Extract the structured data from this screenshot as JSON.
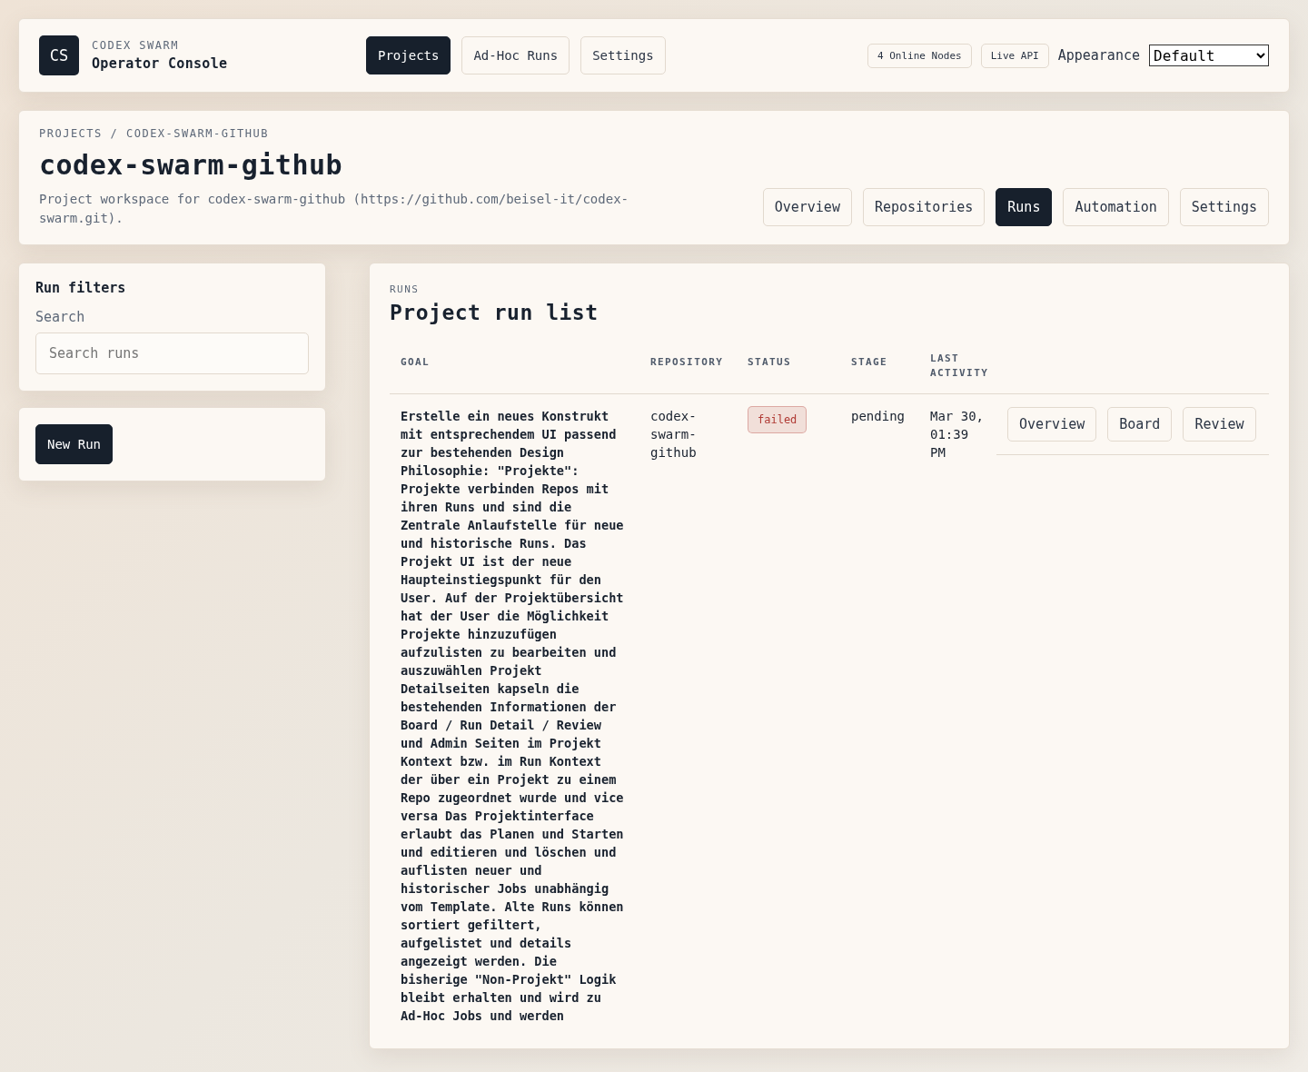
{
  "header": {
    "logo": "CS",
    "eyebrow": "CODEX SWARM",
    "title": "Operator Console",
    "nav": [
      {
        "label": "Projects",
        "selected": true
      },
      {
        "label": "Ad-Hoc Runs",
        "selected": false
      },
      {
        "label": "Settings",
        "selected": false
      }
    ],
    "badges": [
      "4 Online Nodes",
      "Live API"
    ],
    "appearance": {
      "label": "Appearance",
      "value": "Default"
    }
  },
  "project": {
    "breadcrumb": "PROJECTS / CODEX-SWARM-GITHUB",
    "title": "codex-swarm-github",
    "description": "Project workspace for codex-swarm-github (https://github.com/beisel-it/codex-swarm.git).",
    "tabs": [
      {
        "label": "Overview",
        "selected": false
      },
      {
        "label": "Repositories",
        "selected": false
      },
      {
        "label": "Runs",
        "selected": true
      },
      {
        "label": "Automation",
        "selected": false
      },
      {
        "label": "Settings",
        "selected": false
      }
    ]
  },
  "sidebar": {
    "filters": {
      "title": "Run filters",
      "search_label": "Search",
      "search_placeholder": "Search runs"
    },
    "new_run_button": "New Run"
  },
  "runs": {
    "eyebrow": "RUNS",
    "title": "Project run list",
    "columns": [
      "GOAL",
      "REPOSITORY",
      "STATUS",
      "STAGE",
      "LAST ACTIVITY"
    ],
    "rows": [
      {
        "goal": "Erstelle ein neues Konstrukt mit entsprechendem UI passend zur bestehenden Design Philosophie: \"Projekte\": Projekte verbinden Repos mit ihren Runs und sind die Zentrale Anlaufstelle für neue und historische Runs. Das Projekt UI ist der neue Haupteinstiegspunkt für den User. Auf der Projektübersicht hat der User die Möglichkeit Projekte hinzuzufügen aufzulisten zu bearbeiten und auszuwählen Projekt Detailseiten kapseln die bestehenden Informationen der Board / Run Detail / Review und Admin Seiten im Projekt Kontext bzw. im Run Kontext der über ein Projekt zu einem Repo zugeordnet wurde und vice versa Das Projektinterface erlaubt das Planen und Starten und editieren und löschen und auflisten neuer und historischer Jobs unabhängig vom Template. Alte Runs können sortiert gefiltert, aufgelistet und details angezeigt werden. Die bisherige \"Non-Projekt\" Logik bleibt erhalten und wird zu Ad-Hoc Jobs und werden",
        "repository": "codex-swarm-github",
        "status": "failed",
        "color": "#b03a34",
        "stage": "pending",
        "last_activity": "Mar 30, 01:39 PM",
        "actions": [
          "Overview",
          "Board",
          "Review"
        ]
      }
    ]
  }
}
